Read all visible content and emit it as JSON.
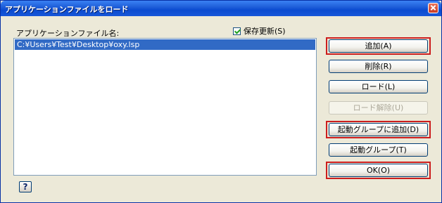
{
  "window": {
    "title": "アプリケーションファイルをロード"
  },
  "list": {
    "label": "アプリケーションファイル名:",
    "items": [
      "C:¥Users¥Test¥Desktop¥oxy.lsp"
    ]
  },
  "save_update": {
    "label": "保存更新(S)",
    "checked": true
  },
  "buttons": {
    "add": "追加(A)",
    "remove": "削除(R)",
    "load": "ロード(L)",
    "unload": "ロード解除(U)",
    "startup_add": "起動グループに追加(D)",
    "startup": "起動グループ(T)",
    "ok": "OK(O)"
  },
  "help": {
    "glyph": "?"
  },
  "icons": {
    "close": "close-icon",
    "check": "checkmark-icon",
    "help": "help-icon"
  },
  "colors": {
    "highlight_border": "#cc1d1d",
    "selection": "#316ac5",
    "titlebar": "#0b4bd0"
  }
}
